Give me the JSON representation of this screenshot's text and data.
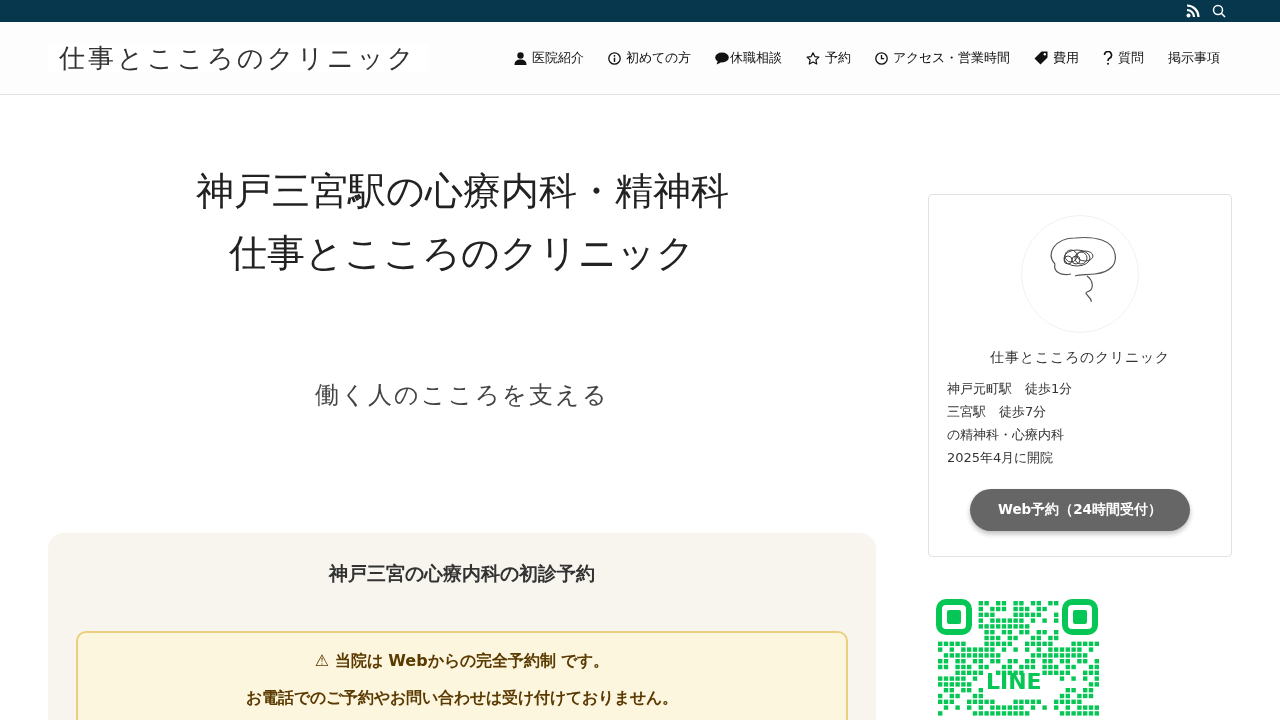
{
  "header": {
    "logo": "仕事とこころのクリニック",
    "nav": [
      {
        "label": "医院紹介"
      },
      {
        "label": "初めての方"
      },
      {
        "label": "休職相談"
      },
      {
        "label": "予約"
      },
      {
        "label": "アクセス・営業時間"
      },
      {
        "label": "費用"
      },
      {
        "label": "質問"
      },
      {
        "label": "掲示事項"
      }
    ]
  },
  "hero": {
    "title_lines": [
      "神戸三宮駅の心療内科・精神科",
      "仕事とこころのクリニック"
    ],
    "tagline": "働く人のこころを支える"
  },
  "reservation": {
    "title": "神戸三宮の心療内科の初診予約",
    "notice_lines": [
      "⚠ 当院は **Web**からの完全予約制 です。",
      "お電話でのご予約やお問い合わせは受け付けておりません。"
    ]
  },
  "sidebar": {
    "profile": {
      "name": "仕事とこころのクリニック",
      "lines": [
        "神戸元町駅　徒歩1分",
        "三宮駅　徒歩7分",
        "の精神科・心療内科",
        "2025年4月に開院"
      ],
      "button": "Web予約（24時間受付）"
    },
    "qr_label": "LINE"
  }
}
